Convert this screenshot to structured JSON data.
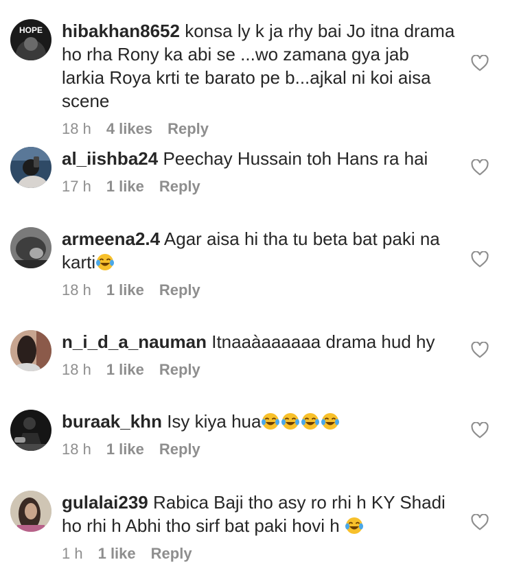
{
  "comments": [
    {
      "username": "hibakhan8652",
      "text": "konsa ly k ja rhy bai Jo itna drama ho rha Rony ka abi se ...wo zamana gya jab larkia Roya krti te barato pe b...ajkal ni koi aisa scene",
      "time": "18 h",
      "likes": "4 likes",
      "reply": "Reply",
      "avatar_text": "HOPE",
      "emoji_count": 0
    },
    {
      "username": "al_iishba24",
      "text": "Peechay Hussain toh Hans ra hai",
      "time": "17 h",
      "likes": "1 like",
      "reply": "Reply",
      "emoji_count": 0
    },
    {
      "username": "armeena2.4",
      "text": "Agar aisa hi tha tu beta bat paki na karti",
      "time": "18 h",
      "likes": "1 like",
      "reply": "Reply",
      "emoji_count": 1
    },
    {
      "username": "n_i_d_a_nauman",
      "text": "Itnaaàaaaaaa drama hud hy",
      "time": "18 h",
      "likes": "1 like",
      "reply": "Reply",
      "emoji_count": 0
    },
    {
      "username": "buraak_khn",
      "text": "Isy kiya hua",
      "time": "18 h",
      "likes": "1 like",
      "reply": "Reply",
      "emoji_count": 4
    },
    {
      "username": "gulalai239",
      "text": "Rabica Baji tho asy ro rhi h KY Shadi ho rhi h Abhi tho sirf bat paki hovi h ",
      "time": "1 h",
      "likes": "1 like",
      "reply": "Reply",
      "emoji_count": 1
    }
  ],
  "icons": {
    "like": "heart-outline-icon",
    "emoji": "face-with-tears-of-joy-emoji"
  },
  "colors": {
    "text": "#262626",
    "meta": "#8e8e8e",
    "icon": "#8e8e8e"
  }
}
